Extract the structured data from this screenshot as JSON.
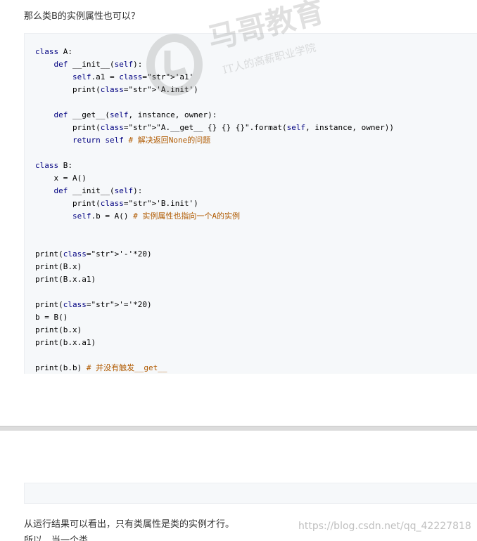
{
  "question": "那么类B的实例属性也可以？",
  "code_lines": [
    "class A:",
    "    def __init__(self):",
    "        self.a1 = 'a1'",
    "        print('A.init')",
    "",
    "    def __get__(self, instance, owner):",
    "        print(\"A.__get__ {} {} {}\".format(self, instance, owner))",
    "        return self # 解决返回None的问题",
    "",
    "class B:",
    "    x = A()",
    "    def __init__(self):",
    "        print('B.init')",
    "        self.b = A() # 实例属性也指向一个A的实例",
    "",
    "",
    "print('-'*20)",
    "print(B.x)",
    "print(B.x.a1)",
    "",
    "print('='*20)",
    "b = B()",
    "print(b.x)",
    "print(b.x.a1)",
    "",
    "print(b.b) # 并没有触发__get__"
  ],
  "watermark": {
    "brand": "马哥教育",
    "slogan": "IT人的高薪职业学院"
  },
  "conclusion": "从运行结果可以看出，只有类属性是类的实例才行。",
  "csdn_watermark": "https://blog.csdn.net/qq_42227818",
  "cutoff_text": "所以，当一个类"
}
